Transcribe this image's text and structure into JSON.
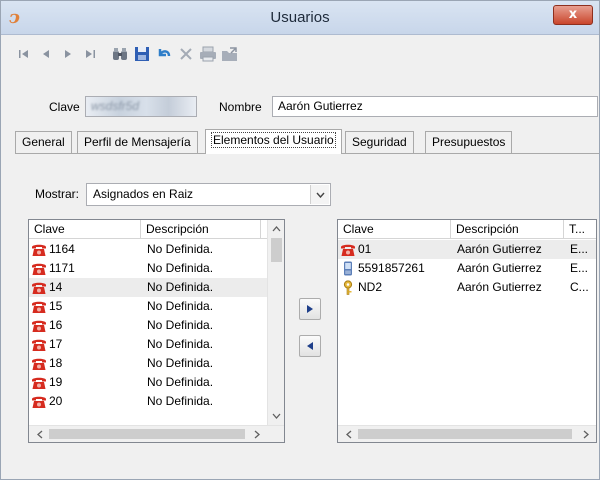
{
  "window": {
    "title": "Usuarios",
    "close_label": "x"
  },
  "toolbar": {
    "buttons": [
      "first-record",
      "previous-record",
      "next-record",
      "last-record",
      "binoculars",
      "save",
      "undo",
      "delete",
      "print",
      "export"
    ]
  },
  "form": {
    "clave_label": "Clave",
    "clave_value": "wsdsfr5d",
    "nombre_label": "Nombre",
    "nombre_value": "Aarón Gutierrez"
  },
  "tabs": [
    {
      "label": "General"
    },
    {
      "label": "Perfil de Mensajería"
    },
    {
      "label": "Elementos del Usuario",
      "active": true
    },
    {
      "label": "Seguridad"
    },
    {
      "label": "Presupuestos"
    }
  ],
  "mostrar": {
    "label": "Mostrar:",
    "value": "Asignados en Raiz"
  },
  "left_grid": {
    "columns": [
      "Clave",
      "Descripción"
    ],
    "rows": [
      {
        "clave": "1164",
        "descripcion": "No Definida.",
        "icon": "phone-icon"
      },
      {
        "clave": "1171",
        "descripcion": "No Definida.",
        "icon": "phone-icon"
      },
      {
        "clave": "14",
        "descripcion": "No Definida.",
        "icon": "phone-icon",
        "selected": true
      },
      {
        "clave": "15",
        "descripcion": "No Definida.",
        "icon": "phone-icon"
      },
      {
        "clave": "16",
        "descripcion": "No Definida.",
        "icon": "phone-icon"
      },
      {
        "clave": "17",
        "descripcion": "No Definida.",
        "icon": "phone-icon"
      },
      {
        "clave": "18",
        "descripcion": "No Definida.",
        "icon": "phone-icon"
      },
      {
        "clave": "19",
        "descripcion": "No Definida.",
        "icon": "phone-icon"
      },
      {
        "clave": "20",
        "descripcion": "No Definida.",
        "icon": "phone-icon"
      }
    ]
  },
  "right_grid": {
    "columns": [
      "Clave",
      "Descripción",
      "T..."
    ],
    "rows": [
      {
        "clave": "01",
        "descripcion": "Aarón Gutierrez",
        "tipo": "E...",
        "icon": "phone-icon",
        "selected": true
      },
      {
        "clave": "5591857261",
        "descripcion": "Aarón Gutierrez",
        "tipo": "E...",
        "icon": "mobile-phone-icon"
      },
      {
        "clave": "ND2",
        "descripcion": "Aarón Gutierrez",
        "tipo": "C...",
        "icon": "key-icon"
      }
    ]
  },
  "colors": {
    "title_bar": "#c8d6ea",
    "close_button": "#c9462c",
    "phone_icon": "#d62b1f",
    "selected_row": "#ececec"
  }
}
